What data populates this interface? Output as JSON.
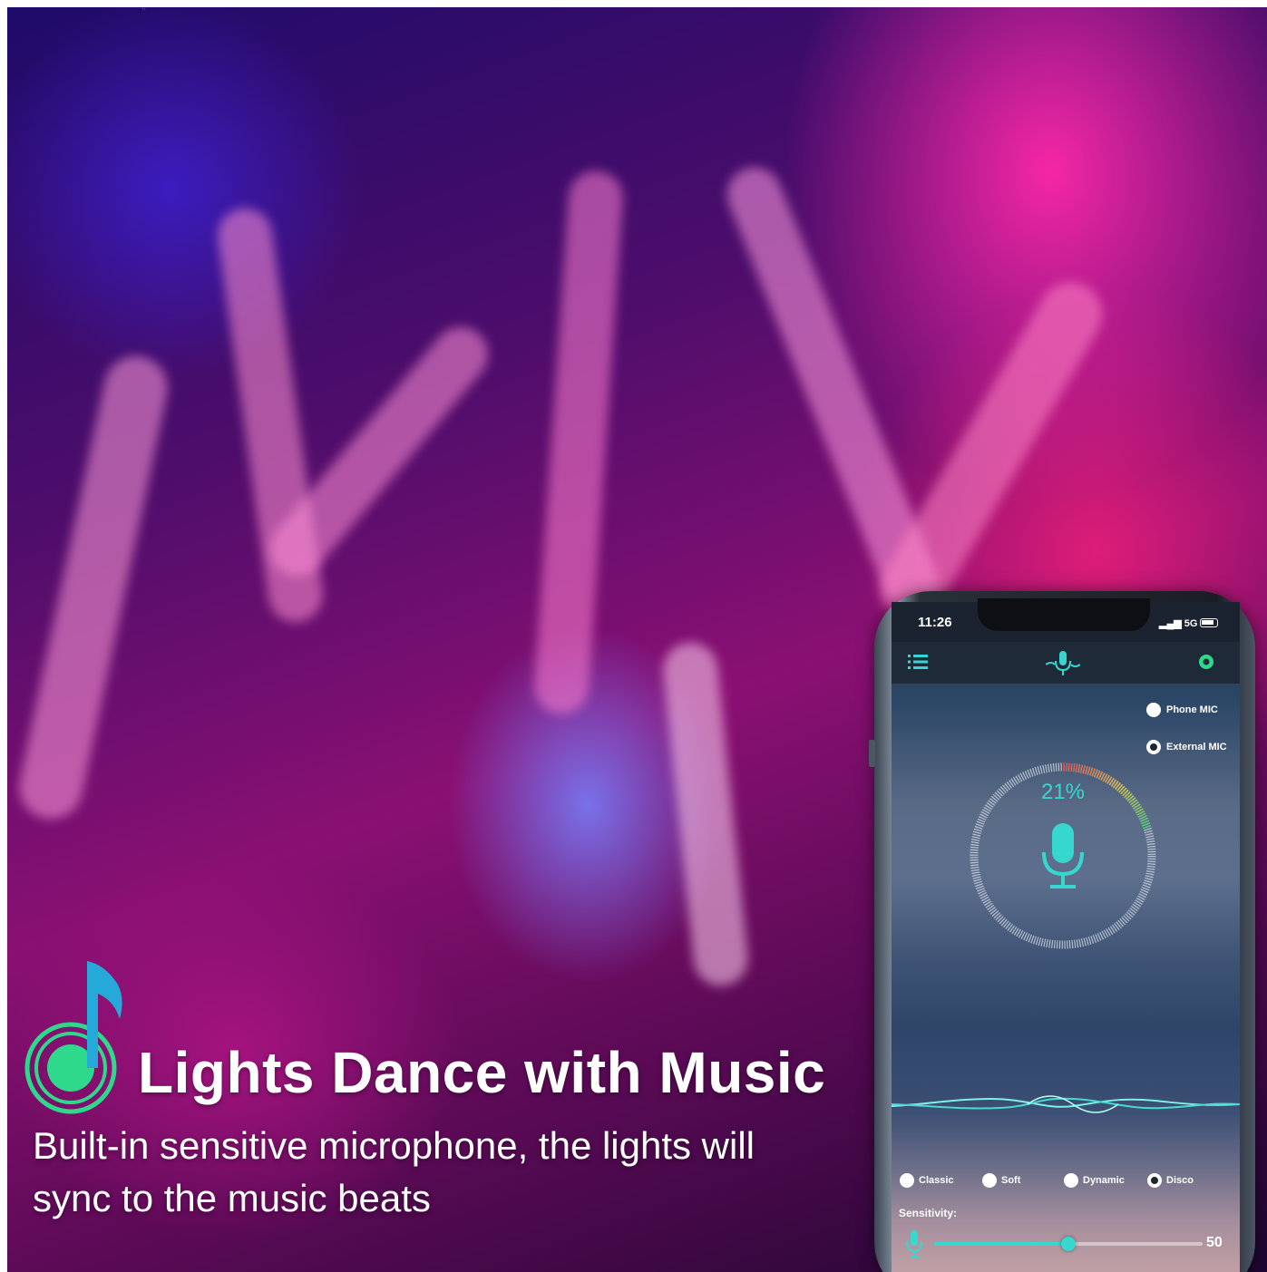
{
  "top_mark": "„",
  "headline": "Lights Dance with Music",
  "description": "Built-in sensitive microphone, the lights will sync to the music beats",
  "colors": {
    "accent": "#36d7cf",
    "icon_green": "#2fd98c"
  },
  "phone": {
    "status_bar": {
      "time": "11:26",
      "network": "5G"
    },
    "app_bar": {
      "menu_icon": "list-icon",
      "center_icon": "microphone-wave-icon",
      "right_icon": "settings-icon"
    },
    "mic_source": [
      {
        "label": "Phone MIC",
        "selected": false
      },
      {
        "label": "External MIC",
        "selected": true
      }
    ],
    "level_percent": "21%",
    "modes": [
      {
        "label": "Classic",
        "selected": false
      },
      {
        "label": "Soft",
        "selected": false
      },
      {
        "label": "Dynamic",
        "selected": false
      },
      {
        "label": "Disco",
        "selected": true
      }
    ],
    "sensitivity": {
      "label": "Sensitivity:",
      "value": "50",
      "level": 0.5
    }
  }
}
